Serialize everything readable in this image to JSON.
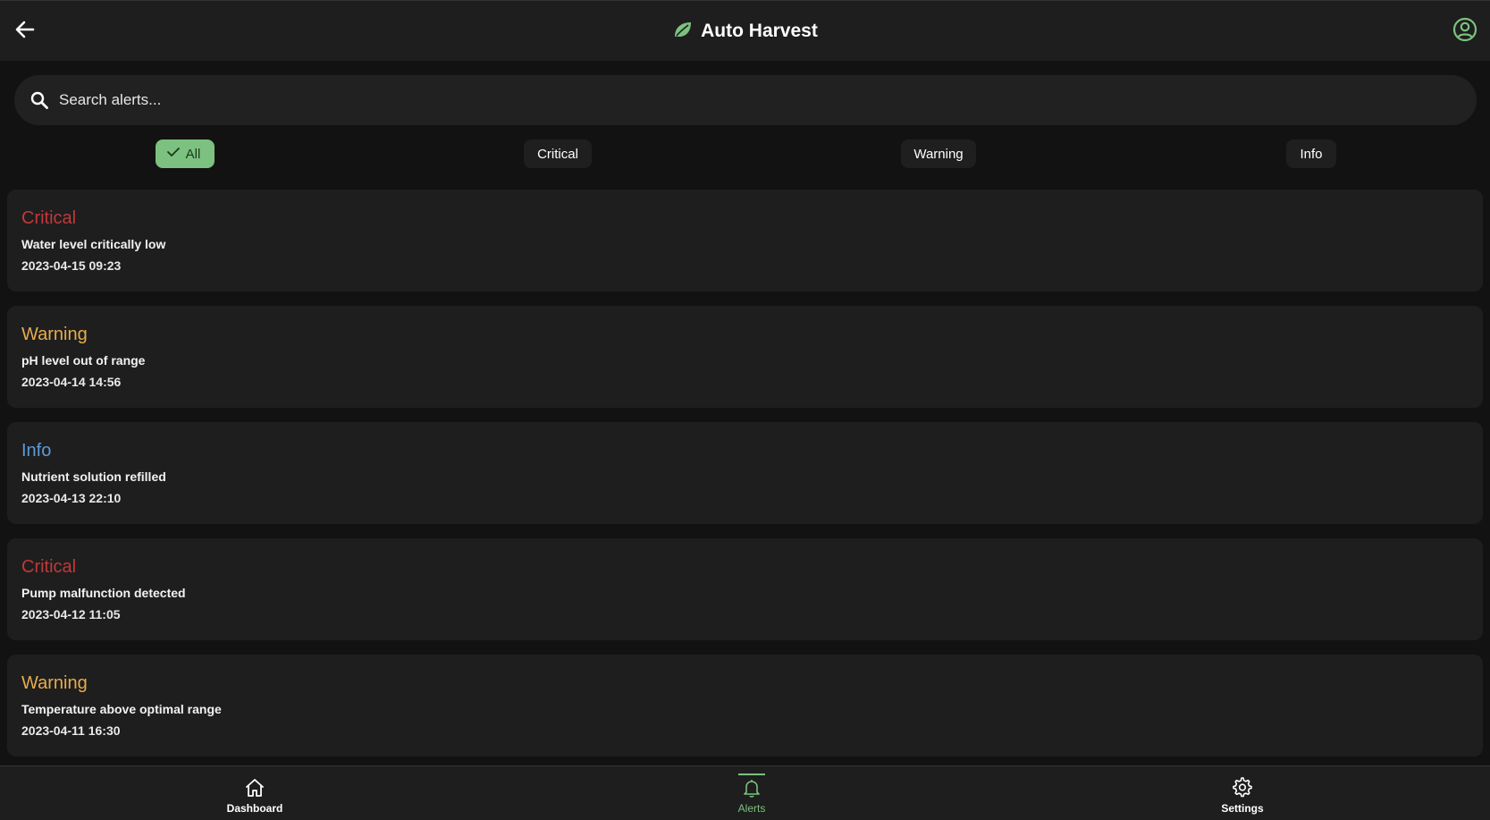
{
  "header": {
    "title": "Auto Harvest",
    "logo_icon": "leaf-icon",
    "back_icon": "arrow-left-icon",
    "profile_icon": "account-circle-icon"
  },
  "search": {
    "placeholder": "Search alerts...",
    "value": ""
  },
  "filters": {
    "selected": "All",
    "chips": [
      {
        "label": "All"
      },
      {
        "label": "Critical"
      },
      {
        "label": "Warning"
      },
      {
        "label": "Info"
      }
    ]
  },
  "alerts": [
    {
      "severity": "Critical",
      "message": "Water level critically low",
      "timestamp": "2023-04-15 09:23"
    },
    {
      "severity": "Warning",
      "message": "pH level out of range",
      "timestamp": "2023-04-14 14:56"
    },
    {
      "severity": "Info",
      "message": "Nutrient solution refilled",
      "timestamp": "2023-04-13 22:10"
    },
    {
      "severity": "Critical",
      "message": "Pump malfunction detected",
      "timestamp": "2023-04-12 11:05"
    },
    {
      "severity": "Warning",
      "message": "Temperature above optimal range",
      "timestamp": "2023-04-11 16:30"
    }
  ],
  "bottom_nav": {
    "active": "Alerts",
    "items": [
      {
        "label": "Dashboard",
        "icon": "home-icon"
      },
      {
        "label": "Alerts",
        "icon": "bell-icon"
      },
      {
        "label": "Settings",
        "icon": "gear-icon"
      }
    ]
  },
  "colors": {
    "background": "#121212",
    "surface": "#1e1e1e",
    "accent": "#7cc17f",
    "critical": "#c0393b",
    "warning": "#e8ac4c",
    "info": "#5b9bd9"
  }
}
